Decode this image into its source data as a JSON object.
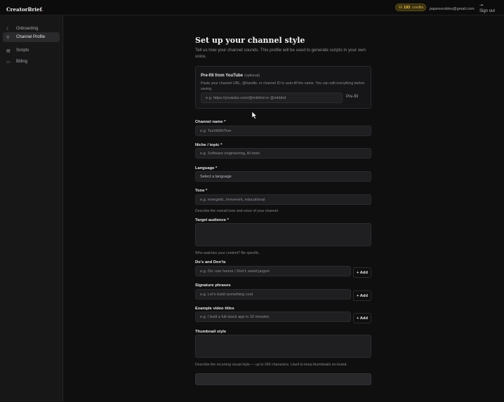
{
  "app": {
    "logo_text": "CreatorBrief",
    "logo_dot": "."
  },
  "header": {
    "credits_count": "193",
    "credits_label": "credits",
    "email": "pajaresrobles@gmail.com",
    "signout_label": "Sign out"
  },
  "sidebar": {
    "items": [
      {
        "label": "Onboarding",
        "icon": "moon-icon"
      },
      {
        "label": "Channel Profile",
        "icon": "user-icon",
        "active": true
      },
      {
        "label": "Scripts",
        "icon": "document-icon"
      },
      {
        "label": "Billing",
        "icon": "card-icon"
      }
    ]
  },
  "page": {
    "title": "Set up your channel style",
    "subtitle": "Tell us how your channel sounds. This profile will be used to generate scripts in your own voice."
  },
  "youtube": {
    "title": "Pre-fill from YouTube",
    "optional": "(optional)",
    "help": "Paste your channel URL, @handle, or channel ID to auto-fill the name. You can edit everything before saving.",
    "placeholder": "e.g. https://youtube.com/@mkbhd or @mkbhd",
    "button": "Pre-fill"
  },
  "form": {
    "channel_name": {
      "label": "Channel name",
      "req": "*",
      "placeholder": "e.g. TechWithTom"
    },
    "niche": {
      "label": "Niche / topic",
      "req": "*",
      "placeholder": "e.g. Software engineering, AI tools"
    },
    "language": {
      "label": "Language",
      "req": "*",
      "value": "Select a language"
    },
    "tone": {
      "label": "Tone",
      "req": "*",
      "placeholder": "e.g. energetic, irreverent, educational",
      "help": "Describe the overall tone and voice of your channel."
    },
    "audience": {
      "label": "Target audience",
      "req": "*",
      "help": "Who watches your content? Be specific."
    },
    "dos": {
      "label": "Do's and Don'ts",
      "placeholder": "e.g. Do: use humor / Don't: avoid jargon",
      "add": "+ Add"
    },
    "phrases": {
      "label": "Signature phrases",
      "placeholder": "e.g. Let's build something cool",
      "add": "+ Add"
    },
    "titles": {
      "label": "Example video titles",
      "placeholder": "e.g. I built a full-stack app in 10 minutes",
      "add": "+ Add"
    },
    "thumbnail": {
      "label": "Thumbnail style",
      "help": "Describe the recurring visual style — up to 240 characters. Used to keep thumbnails on-brand."
    }
  },
  "colors": {
    "accent_credit": "#d9b43c",
    "logo_dot": "#e5484d",
    "background": "#0f0f10"
  }
}
